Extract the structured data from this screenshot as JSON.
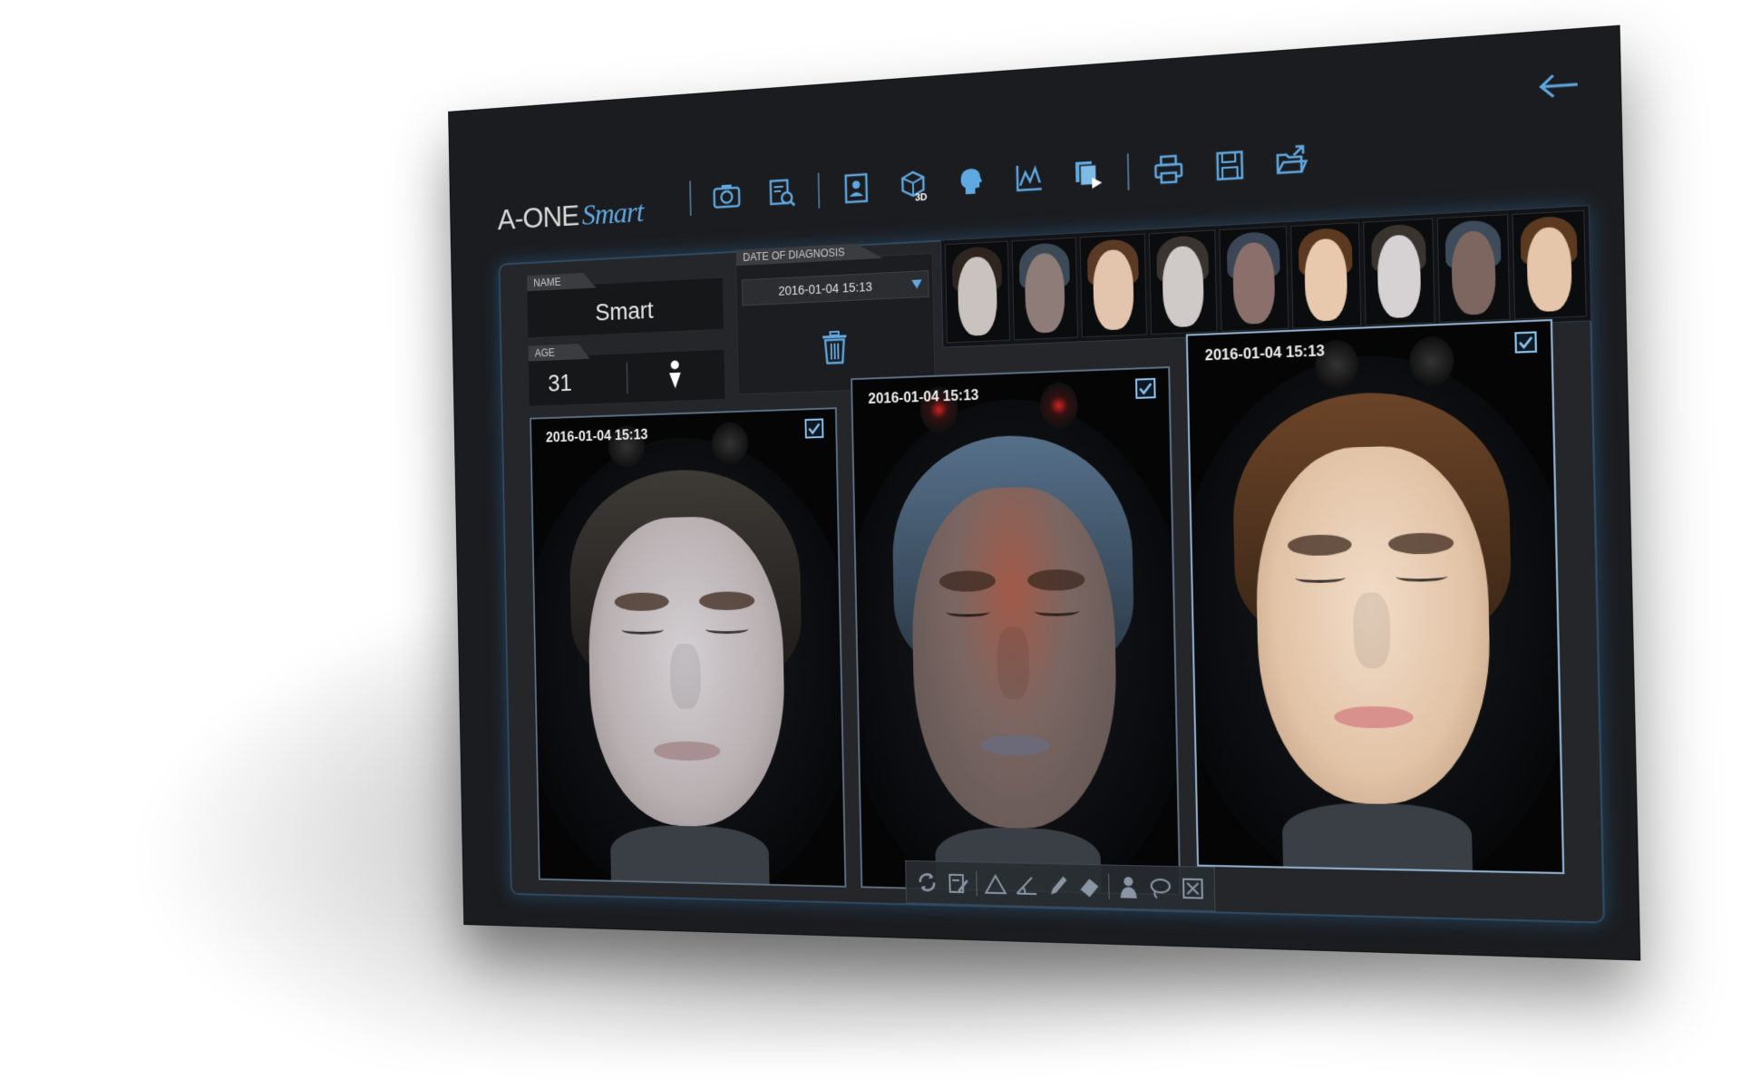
{
  "app": {
    "brand": "A-ONE",
    "brand_accent": "Smart"
  },
  "toolbar": {
    "icons": [
      "camera-icon",
      "report-search-icon",
      "patient-card-icon",
      "cube-3d-icon",
      "profile-head-icon",
      "chart-icon",
      "slideshow-icon",
      "printer-icon",
      "save-disk-icon",
      "open-folder-icon"
    ],
    "label_3d": "3D"
  },
  "patient": {
    "name_label": "NAME",
    "name": "Smart",
    "age_label": "AGE",
    "age": "31"
  },
  "diagnosis": {
    "label": "DATE OF DIAGNOSIS",
    "selected_date": "2016-01-04 15:13"
  },
  "photos": [
    {
      "date": "2016-01-04 15:13",
      "checked": true
    },
    {
      "date": "2016-01-04 15:13",
      "checked": true
    },
    {
      "date": "2016-01-04 15:13",
      "checked": true
    }
  ],
  "thumbnail_count": 9,
  "colors": {
    "accent": "#5fa8e0",
    "panel_glow": "#3c8cd2",
    "background": "#1b1c1f"
  }
}
